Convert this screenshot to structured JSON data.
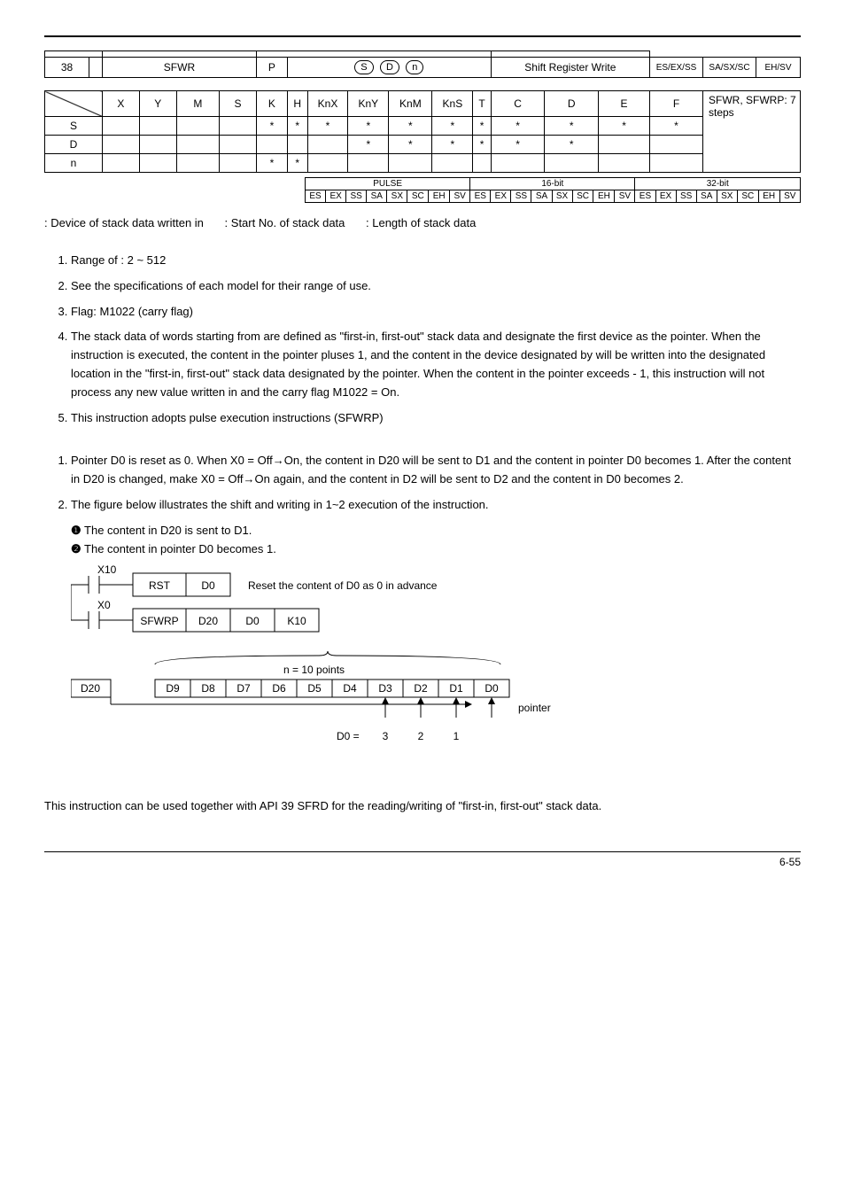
{
  "header_row": {
    "api": "38",
    "mnemonic": "SFWR",
    "p": "P",
    "function": "Shift Register Write",
    "controllers": [
      "ES/EX/SS",
      "SA/SX/SC",
      "EH/SV"
    ]
  },
  "cols": [
    "X",
    "Y",
    "M",
    "S",
    "K",
    "H",
    "KnX",
    "KnY",
    "KnM",
    "KnS",
    "T",
    "C",
    "D",
    "E",
    "F"
  ],
  "steps": "SFWR, SFWRP: 7 steps",
  "rows": [
    {
      "label": "S",
      "stars": [
        "",
        "",
        "",
        "",
        "*",
        "*",
        "*",
        "*",
        "*",
        "*",
        "*",
        "*",
        "*",
        "*",
        "*"
      ]
    },
    {
      "label": "D",
      "stars": [
        "",
        "",
        "",
        "",
        "",
        "",
        "",
        "*",
        "*",
        "*",
        "*",
        "*",
        "*",
        "",
        ""
      ]
    },
    {
      "label": "n",
      "stars": [
        "",
        "",
        "",
        "",
        "*",
        "*",
        "",
        "",
        "",
        "",
        "",
        "",
        "",
        "",
        ""
      ]
    }
  ],
  "bits": {
    "groups": [
      "PULSE",
      "16-bit",
      "32-bit"
    ],
    "cells": [
      "ES",
      "EX",
      "SS",
      "SA",
      "SX",
      "SC",
      "EH",
      "SV"
    ]
  },
  "operands": [
    ": Device of stack data written in",
    ": Start No. of stack data",
    ": Length of stack data"
  ],
  "explanations": [
    "Range of   : 2 ~ 512",
    "See the specifications of each model for their range of use.",
    "Flag: M1022 (carry flag)",
    "The stack data of   words starting from   are defined as \"first-in, first-out\" stack data and designate the first device as the pointer. When the instruction is executed, the content in the pointer pluses 1, and the content in the device designated by   will be written into the designated location in the \"first-in, first-out\" stack data designated by the pointer. When the content in the pointer exceeds   - 1, this instruction will not process any new value written in and the carry flag M1022 = On.",
    "This instruction adopts pulse execution instructions (SFWRP)"
  ],
  "program_example": [
    "Pointer D0 is reset as 0. When X0 = Off→On, the content in D20 will be sent to D1 and the content in pointer D0 becomes 1. After the content in D20 is changed, make X0 = Off→On again, and the content in D2 will be sent to D2 and the content in D0 becomes 2.",
    "The figure below illustrates the shift and writing in 1~2 execution of the instruction."
  ],
  "bullets": [
    "The content in D20 is sent to D1.",
    "The content in pointer D0 becomes 1."
  ],
  "diagram": {
    "x10": "X10",
    "x0": "X0",
    "rst": "RST",
    "d0": "D0",
    "reset_text": "Reset the content of D0 as 0 in advance",
    "sfwrp": "SFWRP",
    "d20": "D20",
    "k10": "K10",
    "n_label": "n = 10 points",
    "src": "D20",
    "cells": [
      "D9",
      "D8",
      "D7",
      "D6",
      "D5",
      "D4",
      "D3",
      "D2",
      "D1",
      "D0"
    ],
    "ptr": "pointer",
    "d0eq": "D0 =",
    "nums": [
      "3",
      "2",
      "1"
    ]
  },
  "remark": "This instruction can be used together with API 39 SFRD for the reading/writing of \"first-in, first-out\" stack data.",
  "page": "6-55"
}
